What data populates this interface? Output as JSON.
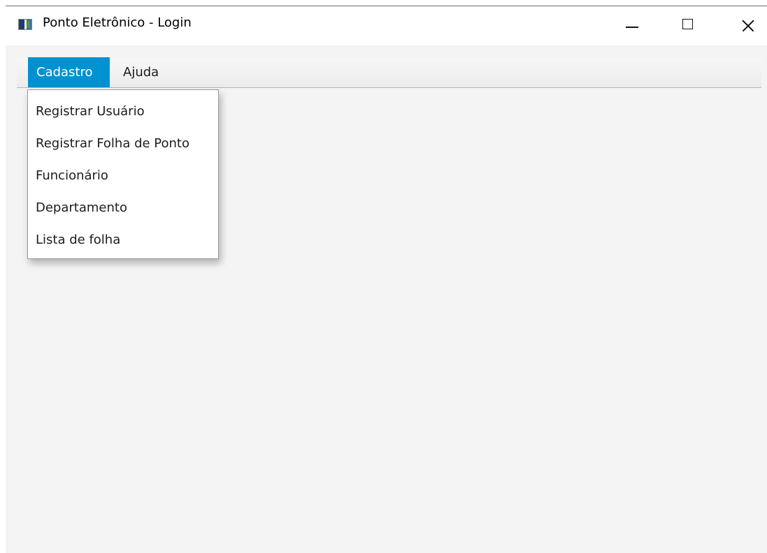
{
  "window": {
    "title": "Ponto Eletrônico - Login",
    "icon": "java-app-icon"
  },
  "window_controls": {
    "minimize": "minimize-icon",
    "maximize": "maximize-icon",
    "close": "close-icon"
  },
  "menubar": {
    "menus": [
      {
        "label": "Cadastro",
        "state": "open"
      },
      {
        "label": "Ajuda"
      }
    ]
  },
  "dropdown": {
    "items": [
      {
        "label": "Registrar Usuário"
      },
      {
        "label": "Registrar Folha de Ponto"
      },
      {
        "label": "Funcionário"
      },
      {
        "label": "Departamento"
      },
      {
        "label": "Lista de folha"
      }
    ]
  },
  "colors": {
    "menu_highlight": "#0092d0",
    "content_background": "#f4f4f4"
  }
}
